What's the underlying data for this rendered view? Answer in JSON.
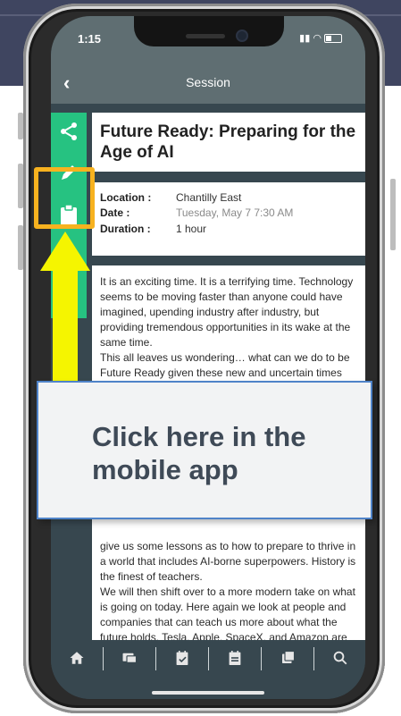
{
  "status": {
    "time": "1:15"
  },
  "nav": {
    "back_glyph": "‹",
    "title": "Session"
  },
  "rail": {
    "icons": [
      "share-icon",
      "pencil-icon",
      "clipboard-icon",
      "star-icon"
    ]
  },
  "session": {
    "title": "Future Ready: Preparing for the Age of AI",
    "location_label": "Location :",
    "location": "Chantilly East",
    "date_label": "Date :",
    "date": "Tuesday, May 7 7:30 AM",
    "duration_label": "Duration :",
    "duration": "1 hour",
    "description_top": [
      "It is an exciting time. It is a terrifying time. Technology seems to be moving faster than anyone could have imagined, upending industry after industry, but providing tremendous opportunities in its wake at the same time.",
      "This all leaves us wondering… what can we do to be Future Ready given these new and uncertain times brought about by potent technologies like"
    ],
    "description_bottom": [
      "give us some lessons as to how to prepare to thrive in a world that includes AI-borne superpowers. History is the finest of teachers.",
      "We will then shift over to a more modern take on what is going on today. Here again we look at people and companies that can teach us more about what the future holds. Tesla, Apple, SpaceX, and Amazon are remarkable firms with charismatic"
    ]
  },
  "tab_bar": {
    "icons": [
      "home-icon",
      "messages-icon",
      "agenda-icon",
      "calendar-icon",
      "notes-icon",
      "search-icon"
    ]
  },
  "callout": {
    "text": "Click here in the mobile app"
  },
  "colors": {
    "accent_green": "#26c281",
    "highlight": "#f7b21f",
    "arrow": "#f5f500",
    "header": "#5f6e72"
  }
}
